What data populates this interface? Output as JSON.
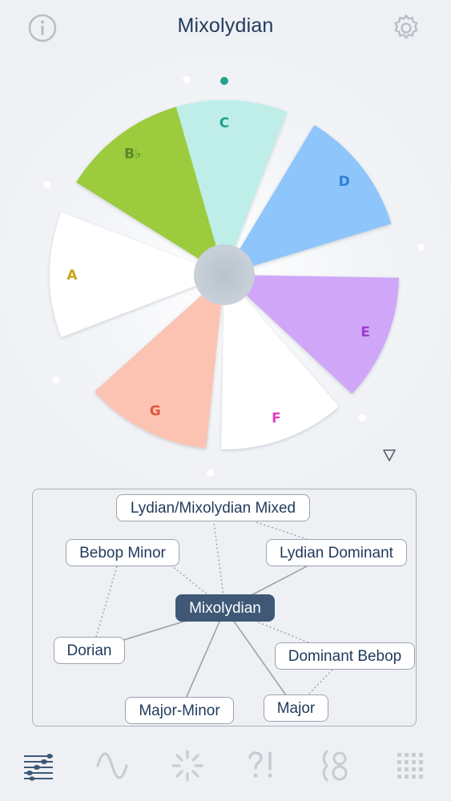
{
  "header": {
    "title": "Mixolydian",
    "info_icon": "info-circle-icon",
    "settings_icon": "gear-icon"
  },
  "wheel": {
    "petals": [
      {
        "label": "C",
        "color": "#bfeee9",
        "text_color": "#1f9e8e"
      },
      {
        "label": "D",
        "color": "#8ec5fb",
        "text_color": "#2f7ed6"
      },
      {
        "label": "E",
        "color": "#cfa6f8",
        "text_color": "#9b3fd6"
      },
      {
        "label": "F",
        "color": "#ffffff",
        "text_color": "#e040c0"
      },
      {
        "label": "G",
        "color": "#fdc3b2",
        "text_color": "#e0543c"
      },
      {
        "label": "A",
        "color": "#ffffff",
        "text_color": "#c7a419"
      },
      {
        "label": "B♭",
        "color": "#9ccb3c",
        "text_color": "#5a8a2a"
      }
    ],
    "expand_icon": "triangle-down-icon"
  },
  "graph": {
    "center": "Mixolydian",
    "nodes": [
      {
        "id": "lydian-mixolydian-mixed",
        "label": "Lydian/Mixolydian Mixed"
      },
      {
        "id": "bebop-minor",
        "label": "Bebop Minor"
      },
      {
        "id": "lydian-dominant",
        "label": "Lydian Dominant"
      },
      {
        "id": "dorian",
        "label": "Dorian"
      },
      {
        "id": "dominant-bebop",
        "label": "Dominant Bebop"
      },
      {
        "id": "major-minor",
        "label": "Major-Minor"
      },
      {
        "id": "major",
        "label": "Major"
      }
    ]
  },
  "bottom_nav": [
    {
      "name": "staff-icon",
      "active": true
    },
    {
      "name": "wave-icon",
      "active": false
    },
    {
      "name": "burst-icon",
      "active": false
    },
    {
      "name": "question-exclamation-icon",
      "active": false
    },
    {
      "name": "numeral-icon",
      "active": false
    },
    {
      "name": "grid-icon",
      "active": false
    }
  ],
  "colors": {
    "accent_dark": "#3e5876",
    "title": "#1f3a5c",
    "inactive_icon": "#c7ccd3"
  }
}
